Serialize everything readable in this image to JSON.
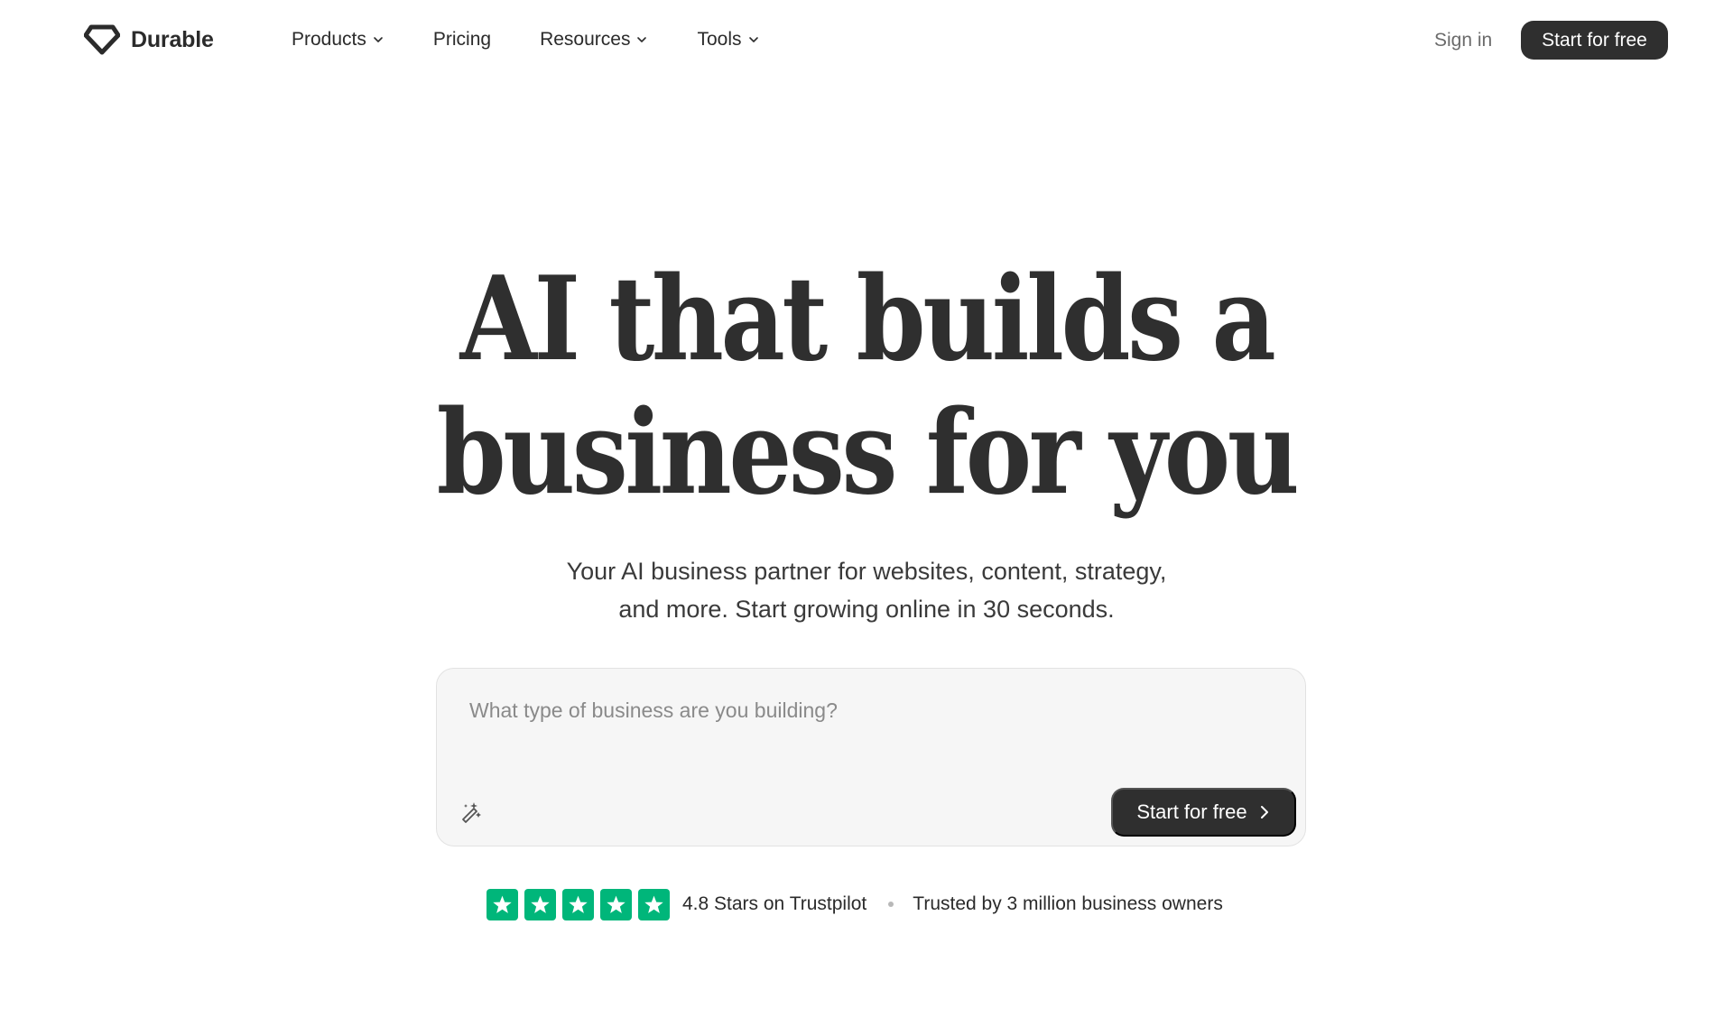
{
  "header": {
    "logo_text": "Durable",
    "nav": [
      {
        "label": "Products",
        "has_dropdown": true
      },
      {
        "label": "Pricing",
        "has_dropdown": false
      },
      {
        "label": "Resources",
        "has_dropdown": true
      },
      {
        "label": "Tools",
        "has_dropdown": true
      }
    ],
    "sign_in_label": "Sign in",
    "cta_label": "Start for free"
  },
  "hero": {
    "headline_line1": "AI that builds a",
    "headline_line2": "business for you",
    "subhead_line1": "Your AI business partner for websites, content, strategy,",
    "subhead_line2": "and more. Start growing online in 30 seconds."
  },
  "prompt": {
    "placeholder": "What type of business are you building?",
    "value": "",
    "icon": "magic-wand-icon",
    "cta_label": "Start for free"
  },
  "social_proof": {
    "rating_stars": 5,
    "rating_text": "4.8 Stars on Trustpilot",
    "trust_text": "Trusted by 3 million business owners"
  },
  "colors": {
    "text": "#2b2b2b",
    "button_bg": "#2f2f2f",
    "trustpilot_green": "#00b67a",
    "input_bg": "#f6f6f6"
  }
}
